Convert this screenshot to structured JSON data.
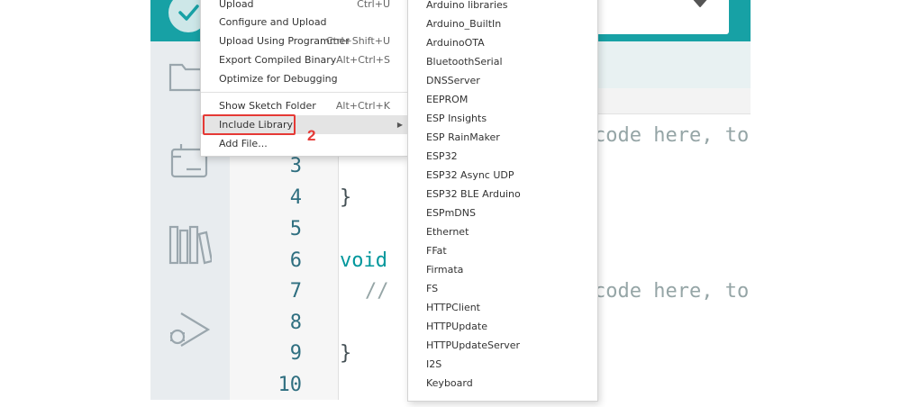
{
  "sketch_menu": {
    "items": [
      {
        "label": "Upload",
        "shortcut": "Ctrl+U"
      },
      {
        "label": "Configure and Upload",
        "shortcut": ""
      },
      {
        "label": "Upload Using Programmer",
        "shortcut": "Ctrl+Shift+U"
      },
      {
        "label": "Export Compiled Binary",
        "shortcut": "Alt+Ctrl+S"
      },
      {
        "label": "Optimize for Debugging",
        "shortcut": ""
      },
      {
        "label": "Show Sketch Folder",
        "shortcut": "Alt+Ctrl+K"
      },
      {
        "label": "Include Library",
        "shortcut": "",
        "active": true,
        "has_submenu": true
      },
      {
        "label": "Add File...",
        "shortcut": ""
      }
    ],
    "arrow_glyph": "▶"
  },
  "annotation": {
    "number": "2",
    "color": "#e53935"
  },
  "library_menu": {
    "items": [
      "Arduino libraries",
      "Arduino_BuiltIn",
      "ArduinoOTA",
      "BluetoothSerial",
      "DNSServer",
      "EEPROM",
      "ESP Insights",
      "ESP RainMaker",
      "ESP32",
      "ESP32 Async UDP",
      "ESP32 BLE Arduino",
      "ESPmDNS",
      "Ethernet",
      "FFat",
      "Firmata",
      "FS",
      "HTTPClient",
      "HTTPUpdate",
      "HTTPUpdateServer",
      "I2S",
      "Keyboard"
    ]
  },
  "editor": {
    "line_numbers": [
      "3",
      "4",
      "5",
      "6",
      "7",
      "8",
      "9",
      "10"
    ],
    "code_fragments": {
      "line2_comment": "code here, to",
      "line4": "}",
      "line6_kw": "void",
      "line7_comment_start": "//",
      "line7_comment_end": "code here, to",
      "line9": "}"
    }
  },
  "colors": {
    "accent": "#17a1a5",
    "sidebar": "#e8ecef",
    "line_number": "#2f6f80"
  },
  "icons": [
    "verify-check-icon",
    "board-chevron-icon",
    "folder-icon",
    "board-manager-icon",
    "library-icon",
    "debug-icon"
  ]
}
